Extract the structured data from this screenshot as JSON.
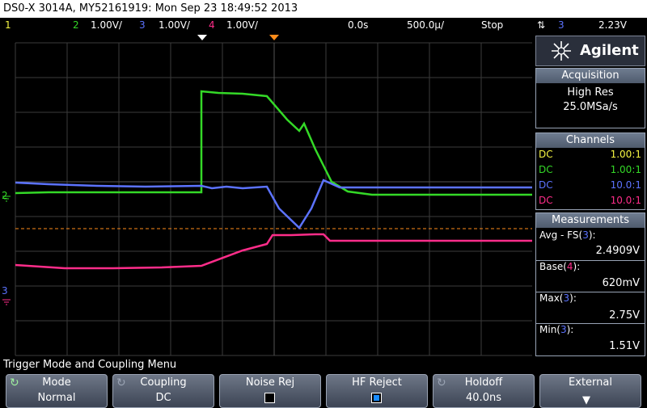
{
  "titlebar": "DS0-X 3014A, MY52161919: Mon Sep 23 18:49:52 2013",
  "status": {
    "ch1": "1",
    "ch2_label": "2",
    "ch2_scale": "1.00V/",
    "ch3_label": "3",
    "ch3_scale": "1.00V/",
    "ch4_label": "4",
    "ch4_scale": "1.00V/",
    "delay": "0.0s",
    "timebase": "500.0µ/",
    "run_state": "Stop",
    "trigger_source": "3",
    "trigger_level": "2.23V"
  },
  "brand": "Agilent",
  "acquisition": {
    "header": "Acquisition",
    "mode": "High Res",
    "rate": "25.0MSa/s"
  },
  "channels": {
    "header": "Channels",
    "rows": [
      {
        "coupling": "DC",
        "ratio": "1.00:1",
        "color": "#f5f542"
      },
      {
        "coupling": "DC",
        "ratio": "1.00:1",
        "color": "#34d927"
      },
      {
        "coupling": "DC",
        "ratio": "10.0:1",
        "color": "#5c73ff"
      },
      {
        "coupling": "DC",
        "ratio": "10.0:1",
        "color": "#ff2d8a"
      }
    ]
  },
  "measurements": {
    "header": "Measurements",
    "items": [
      {
        "name": "Avg - FS(",
        "src": "3",
        "close": "):",
        "value": "2.4909V",
        "src_color": "#5c73ff"
      },
      {
        "name": "Base(",
        "src": "4",
        "close": "):",
        "value": "620mV",
        "src_color": "#ff2d8a"
      },
      {
        "name": "Max(",
        "src": "3",
        "close": "):",
        "value": "2.75V",
        "src_color": "#5c73ff"
      },
      {
        "name": "Min(",
        "src": "3",
        "close": "):",
        "value": "1.51V",
        "src_color": "#5c73ff"
      }
    ]
  },
  "markers": {
    "ch2": "2",
    "ch3": "3"
  },
  "menu": {
    "title": "Trigger Mode and Coupling Menu",
    "keys": [
      {
        "l1": "Mode",
        "l2": "Normal"
      },
      {
        "l1": "Coupling",
        "l2": "DC"
      },
      {
        "l1": "Noise Rej",
        "l2": ""
      },
      {
        "l1": "HF Reject",
        "l2": ""
      },
      {
        "l1": "Holdoff",
        "l2": "40.0ns"
      },
      {
        "l1": "External",
        "l2": ""
      }
    ]
  },
  "colors": {
    "ch1": "#f5f542",
    "ch2": "#34d927",
    "ch3": "#5c73ff",
    "ch4": "#ff2d8a",
    "trigger_line": "#ff8c1a",
    "grid": "#3a3a3a"
  }
}
